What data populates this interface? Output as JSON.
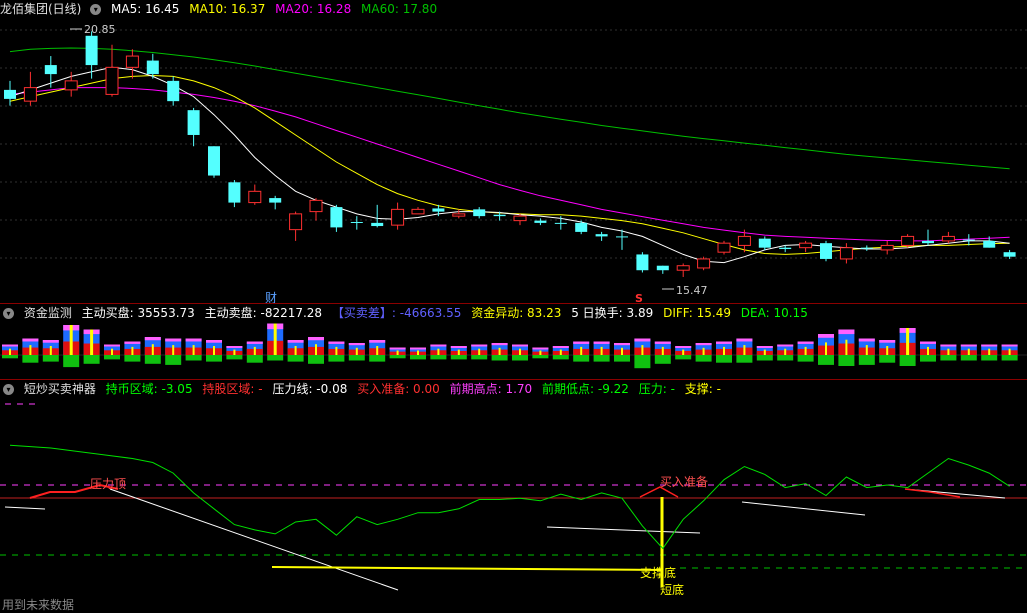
{
  "main_header": {
    "title": "龙佰集团(日线)",
    "ma5": "MA5: 16.45",
    "ma10": "MA10: 16.37",
    "ma20": "MA20: 16.28",
    "ma60": "MA60: 17.80",
    "colors": {
      "ma5": "#ffffff",
      "ma10": "#ffff00",
      "ma20": "#ff00ff",
      "ma60": "#00c000"
    }
  },
  "main_annotations": {
    "high_label": "20.85",
    "low_label": "15.47",
    "marker_cai": "财",
    "marker_s": "S"
  },
  "fund_header": {
    "title": "资金监测",
    "buy": "主动买盘: 35553.73",
    "sell": "主动卖盘: -82217.28",
    "diff_tag": "【买卖差】: -46663.55",
    "abnormal": "资金异动: 83.23",
    "turnover": "5 日换手: 3.89",
    "diff": "DIFF: 15.49",
    "dea": "DEA: 10.15"
  },
  "short_header": {
    "title": "短炒买卖神器",
    "hold": "持币区域: -3.05",
    "holdstock": "持股区域: -",
    "pressure_line": "压力线: -0.08",
    "buy_ready": "买入准备: 0.00",
    "prev_high": "前期高点: 1.70",
    "prev_low": "前期低点: -9.22",
    "pressure": "压力: -",
    "support": "支撑: -"
  },
  "short_annotations": {
    "pressure_top": "压力顶",
    "buy_ready": "买入准备",
    "support_bottom": "支撑底",
    "short_bottom": "短底"
  },
  "footer": "用到未来数据",
  "chart_data": [
    {
      "type": "candlestick",
      "candles": [
        {
          "o": 19.55,
          "c": 19.35,
          "h": 19.75,
          "l": 19.2,
          "up": false
        },
        {
          "o": 19.3,
          "c": 19.6,
          "h": 19.95,
          "l": 19.2,
          "up": true
        },
        {
          "o": 20.1,
          "c": 19.9,
          "h": 20.3,
          "l": 19.6,
          "up": false
        },
        {
          "o": 19.55,
          "c": 19.75,
          "h": 19.95,
          "l": 19.4,
          "up": true
        },
        {
          "o": 20.75,
          "c": 20.1,
          "h": 20.85,
          "l": 19.8,
          "up": false
        },
        {
          "o": 19.45,
          "c": 20.05,
          "h": 20.55,
          "l": 19.4,
          "up": true
        },
        {
          "o": 20.05,
          "c": 20.3,
          "h": 20.45,
          "l": 19.8,
          "up": true
        },
        {
          "o": 20.2,
          "c": 19.9,
          "h": 20.35,
          "l": 19.8,
          "up": false
        },
        {
          "o": 19.75,
          "c": 19.3,
          "h": 19.85,
          "l": 19.2,
          "up": false
        },
        {
          "o": 19.1,
          "c": 18.55,
          "h": 19.15,
          "l": 18.3,
          "up": false
        },
        {
          "o": 18.3,
          "c": 17.65,
          "h": 18.3,
          "l": 17.6,
          "up": false
        },
        {
          "o": 17.5,
          "c": 17.05,
          "h": 17.55,
          "l": 16.95,
          "up": false
        },
        {
          "o": 17.05,
          "c": 17.3,
          "h": 17.45,
          "l": 17.0,
          "up": true
        },
        {
          "o": 17.15,
          "c": 17.05,
          "h": 17.2,
          "l": 16.9,
          "up": false
        },
        {
          "o": 16.45,
          "c": 16.8,
          "h": 16.85,
          "l": 16.2,
          "up": true
        },
        {
          "o": 16.85,
          "c": 17.1,
          "h": 17.15,
          "l": 16.65,
          "up": true
        },
        {
          "o": 16.95,
          "c": 16.5,
          "h": 17.0,
          "l": 16.4,
          "up": false
        },
        {
          "o": 16.6,
          "c": 16.62,
          "h": 16.75,
          "l": 16.45,
          "up": false
        },
        {
          "o": 16.6,
          "c": 16.53,
          "h": 17.0,
          "l": 16.5,
          "up": false
        },
        {
          "o": 16.55,
          "c": 16.9,
          "h": 17.05,
          "l": 16.45,
          "up": true
        },
        {
          "o": 16.8,
          "c": 16.9,
          "h": 16.95,
          "l": 16.8,
          "up": true
        },
        {
          "o": 16.92,
          "c": 16.85,
          "h": 17.0,
          "l": 16.75,
          "up": false
        },
        {
          "o": 16.75,
          "c": 16.8,
          "h": 16.9,
          "l": 16.7,
          "up": true
        },
        {
          "o": 16.9,
          "c": 16.75,
          "h": 16.95,
          "l": 16.7,
          "up": false
        },
        {
          "o": 16.78,
          "c": 16.75,
          "h": 16.85,
          "l": 16.65,
          "up": false
        },
        {
          "o": 16.65,
          "c": 16.75,
          "h": 16.8,
          "l": 16.55,
          "up": true
        },
        {
          "o": 16.65,
          "c": 16.6,
          "h": 16.7,
          "l": 16.55,
          "up": false
        },
        {
          "o": 16.6,
          "c": 16.58,
          "h": 16.75,
          "l": 16.45,
          "up": false
        },
        {
          "o": 16.6,
          "c": 16.4,
          "h": 16.65,
          "l": 16.35,
          "up": false
        },
        {
          "o": 16.35,
          "c": 16.3,
          "h": 16.4,
          "l": 16.2,
          "up": false
        },
        {
          "o": 16.3,
          "c": 16.28,
          "h": 16.45,
          "l": 16.0,
          "up": false
        },
        {
          "o": 15.9,
          "c": 15.55,
          "h": 15.95,
          "l": 15.5,
          "up": false
        },
        {
          "o": 15.65,
          "c": 15.55,
          "h": 15.65,
          "l": 15.47,
          "up": false
        },
        {
          "o": 15.55,
          "c": 15.65,
          "h": 15.7,
          "l": 15.4,
          "up": true
        },
        {
          "o": 15.6,
          "c": 15.8,
          "h": 15.85,
          "l": 15.55,
          "up": true
        },
        {
          "o": 15.95,
          "c": 16.15,
          "h": 16.2,
          "l": 15.9,
          "up": true
        },
        {
          "o": 16.1,
          "c": 16.3,
          "h": 16.45,
          "l": 15.95,
          "up": true
        },
        {
          "o": 16.25,
          "c": 16.05,
          "h": 16.3,
          "l": 16.0,
          "up": false
        },
        {
          "o": 16.05,
          "c": 16.02,
          "h": 16.1,
          "l": 15.95,
          "up": false
        },
        {
          "o": 16.05,
          "c": 16.15,
          "h": 16.2,
          "l": 15.95,
          "up": true
        },
        {
          "o": 16.15,
          "c": 15.8,
          "h": 16.2,
          "l": 15.75,
          "up": false
        },
        {
          "o": 15.8,
          "c": 16.05,
          "h": 16.15,
          "l": 15.7,
          "up": true
        },
        {
          "o": 16.05,
          "c": 16.03,
          "h": 16.1,
          "l": 15.98,
          "up": false
        },
        {
          "o": 16.0,
          "c": 16.1,
          "h": 16.2,
          "l": 15.9,
          "up": true
        },
        {
          "o": 16.1,
          "c": 16.3,
          "h": 16.35,
          "l": 16.05,
          "up": true
        },
        {
          "o": 16.2,
          "c": 16.15,
          "h": 16.45,
          "l": 16.1,
          "up": false
        },
        {
          "o": 16.2,
          "c": 16.3,
          "h": 16.4,
          "l": 16.15,
          "up": true
        },
        {
          "o": 16.23,
          "c": 16.22,
          "h": 16.35,
          "l": 16.1,
          "up": false
        },
        {
          "o": 16.2,
          "c": 16.05,
          "h": 16.3,
          "l": 16.05,
          "up": false
        },
        {
          "o": 15.95,
          "c": 15.85,
          "h": 16.0,
          "l": 15.8,
          "up": false
        }
      ],
      "ma5": [
        19.4,
        19.55,
        19.7,
        19.85,
        19.95,
        20.05,
        20.0,
        19.85,
        19.65,
        19.4,
        19.0,
        18.55,
        18.05,
        17.65,
        17.3,
        17.1,
        16.95,
        16.8,
        16.7,
        16.68,
        16.72,
        16.8,
        16.85,
        16.85,
        16.83,
        16.78,
        16.75,
        16.7,
        16.62,
        16.5,
        16.42,
        16.3,
        16.1,
        15.9,
        15.75,
        15.72,
        15.85,
        16.0,
        16.1,
        16.12,
        16.08,
        16.05,
        16.02,
        16.02,
        16.05,
        16.1,
        16.15,
        16.2,
        16.2,
        16.15
      ],
      "ma10": [
        19.3,
        19.4,
        19.5,
        19.6,
        19.7,
        19.8,
        19.85,
        19.87,
        19.85,
        19.75,
        19.6,
        19.4,
        19.15,
        18.85,
        18.55,
        18.25,
        17.95,
        17.7,
        17.45,
        17.25,
        17.1,
        16.98,
        16.9,
        16.85,
        16.82,
        16.8,
        16.78,
        16.78,
        16.75,
        16.7,
        16.65,
        16.58,
        16.48,
        16.38,
        16.25,
        16.12,
        16.0,
        15.92,
        15.9,
        15.92,
        15.96,
        16.0,
        16.04,
        16.06,
        16.08,
        16.1,
        16.1,
        16.12,
        16.14,
        16.15
      ],
      "ma20": [
        19.45,
        19.5,
        19.55,
        19.6,
        19.6,
        19.6,
        19.58,
        19.55,
        19.5,
        19.45,
        19.38,
        19.3,
        19.2,
        19.08,
        18.95,
        18.8,
        18.65,
        18.5,
        18.35,
        18.2,
        18.05,
        17.9,
        17.75,
        17.6,
        17.45,
        17.32,
        17.2,
        17.1,
        17.0,
        16.9,
        16.82,
        16.74,
        16.66,
        16.58,
        16.5,
        16.44,
        16.38,
        16.33,
        16.3,
        16.28,
        16.26,
        16.24,
        16.22,
        16.21,
        16.2,
        16.2,
        16.22,
        16.24,
        16.26,
        16.28
      ],
      "ma60": [
        20.4,
        20.45,
        20.47,
        20.48,
        20.47,
        20.45,
        20.42,
        20.38,
        20.33,
        20.28,
        20.22,
        20.15,
        20.08,
        20.0,
        19.92,
        19.84,
        19.76,
        19.68,
        19.6,
        19.52,
        19.44,
        19.36,
        19.28,
        19.2,
        19.12,
        19.04,
        18.97,
        18.9,
        18.83,
        18.76,
        18.7,
        18.64,
        18.58,
        18.52,
        18.47,
        18.42,
        18.37,
        18.32,
        18.27,
        18.22,
        18.17,
        18.12,
        18.08,
        18.04,
        18.0,
        17.96,
        17.92,
        17.88,
        17.84,
        17.8
      ],
      "ylim": [
        15.2,
        21.1
      ]
    },
    {
      "type": "bar",
      "name": "资金监测",
      "bars": [
        {
          "up": 0.35,
          "dn": 0.15,
          "hl": false
        },
        {
          "up": 0.55,
          "dn": 0.35,
          "hl": false
        },
        {
          "up": 0.5,
          "dn": 0.3,
          "hl": false
        },
        {
          "up": 1.0,
          "dn": 0.55,
          "hl": true
        },
        {
          "up": 0.85,
          "dn": 0.4,
          "hl": true
        },
        {
          "up": 0.35,
          "dn": 0.2,
          "hl": false
        },
        {
          "up": 0.45,
          "dn": 0.3,
          "hl": false
        },
        {
          "up": 0.6,
          "dn": 0.4,
          "hl": false
        },
        {
          "up": 0.55,
          "dn": 0.45,
          "hl": false
        },
        {
          "up": 0.55,
          "dn": 0.25,
          "hl": false
        },
        {
          "up": 0.5,
          "dn": 0.3,
          "hl": false
        },
        {
          "up": 0.3,
          "dn": 0.2,
          "hl": false
        },
        {
          "up": 0.45,
          "dn": 0.35,
          "hl": false
        },
        {
          "up": 1.05,
          "dn": 0.25,
          "hl": true
        },
        {
          "up": 0.5,
          "dn": 0.3,
          "hl": false
        },
        {
          "up": 0.6,
          "dn": 0.4,
          "hl": false
        },
        {
          "up": 0.45,
          "dn": 0.3,
          "hl": false
        },
        {
          "up": 0.4,
          "dn": 0.25,
          "hl": false
        },
        {
          "up": 0.5,
          "dn": 0.3,
          "hl": false
        },
        {
          "up": 0.25,
          "dn": 0.15,
          "hl": false
        },
        {
          "up": 0.25,
          "dn": 0.2,
          "hl": false
        },
        {
          "up": 0.35,
          "dn": 0.2,
          "hl": false
        },
        {
          "up": 0.3,
          "dn": 0.2,
          "hl": false
        },
        {
          "up": 0.35,
          "dn": 0.2,
          "hl": false
        },
        {
          "up": 0.4,
          "dn": 0.25,
          "hl": false
        },
        {
          "up": 0.35,
          "dn": 0.25,
          "hl": false
        },
        {
          "up": 0.25,
          "dn": 0.15,
          "hl": false
        },
        {
          "up": 0.3,
          "dn": 0.2,
          "hl": false
        },
        {
          "up": 0.45,
          "dn": 0.3,
          "hl": false
        },
        {
          "up": 0.45,
          "dn": 0.3,
          "hl": false
        },
        {
          "up": 0.4,
          "dn": 0.3,
          "hl": false
        },
        {
          "up": 0.55,
          "dn": 0.6,
          "hl": false
        },
        {
          "up": 0.45,
          "dn": 0.4,
          "hl": false
        },
        {
          "up": 0.3,
          "dn": 0.2,
          "hl": false
        },
        {
          "up": 0.4,
          "dn": 0.3,
          "hl": false
        },
        {
          "up": 0.45,
          "dn": 0.35,
          "hl": false
        },
        {
          "up": 0.55,
          "dn": 0.35,
          "hl": false
        },
        {
          "up": 0.3,
          "dn": 0.25,
          "hl": false
        },
        {
          "up": 0.35,
          "dn": 0.25,
          "hl": false
        },
        {
          "up": 0.45,
          "dn": 0.3,
          "hl": false
        },
        {
          "up": 0.7,
          "dn": 0.45,
          "hl": false
        },
        {
          "up": 0.85,
          "dn": 0.5,
          "hl": false
        },
        {
          "up": 0.55,
          "dn": 0.45,
          "hl": false
        },
        {
          "up": 0.5,
          "dn": 0.35,
          "hl": false
        },
        {
          "up": 0.9,
          "dn": 0.5,
          "hl": true
        },
        {
          "up": 0.45,
          "dn": 0.3,
          "hl": false
        },
        {
          "up": 0.35,
          "dn": 0.25,
          "hl": false
        },
        {
          "up": 0.35,
          "dn": 0.25,
          "hl": false
        },
        {
          "up": 0.35,
          "dn": 0.25,
          "hl": false
        },
        {
          "up": 0.35,
          "dn": 0.25,
          "hl": false
        }
      ]
    },
    {
      "type": "line",
      "name": "短炒买卖神器",
      "green_line": [
        1.6,
        1.5,
        1.4,
        1.2,
        1.0,
        0.8,
        0.6,
        0.3,
        -0.5,
        -2.0,
        -3.2,
        -4.4,
        -4.8,
        -5.1,
        -4.2,
        -4.0,
        -5.2,
        -3.8,
        -4.4,
        -4.0,
        -3.5,
        -3.5,
        -3.2,
        -2.5,
        -2.5,
        -2.4,
        -2.6,
        -2.1,
        -2.5,
        -2.0,
        -2.4,
        -4.5,
        -6.2,
        -4.0,
        -2.6,
        -1.0,
        0.0,
        -0.6,
        -1.6,
        -1.3,
        -2.2,
        -0.8,
        -1.6,
        -1.4,
        -1.6,
        -0.5,
        0.6,
        0.1,
        -0.5,
        -1.5
      ],
      "red_segments_note": "",
      "ylim": [
        -9.5,
        4.5
      ]
    }
  ]
}
